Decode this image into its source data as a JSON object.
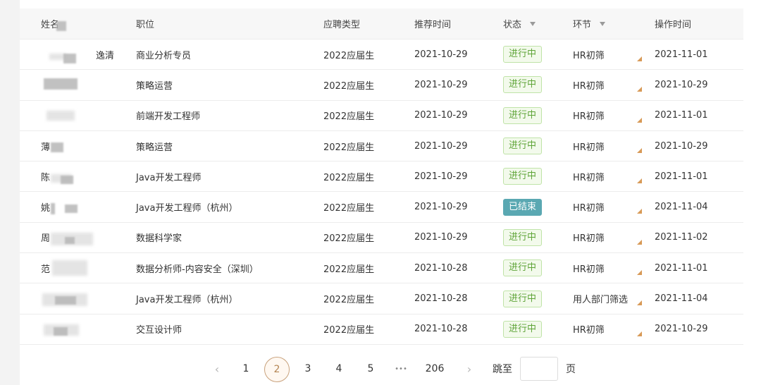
{
  "table": {
    "headers": {
      "name": "姓名",
      "position": "职位",
      "type": "应聘类型",
      "rec_time": "推荐时间",
      "status": "状态",
      "stage": "环节",
      "op_time": "操作时间"
    },
    "rows": [
      {
        "name": "逸清",
        "position": "商业分析专员",
        "type": "2022应届生",
        "rec_time": "2021-10-29",
        "status": "进行中",
        "status_kind": "ongoing",
        "stage": "HR初筛",
        "op_time": "2021-11-01"
      },
      {
        "name": "",
        "position": "策略运营",
        "type": "2022应届生",
        "rec_time": "2021-10-29",
        "status": "进行中",
        "status_kind": "ongoing",
        "stage": "HR初筛",
        "op_time": "2021-10-29"
      },
      {
        "name": "",
        "position": "前端开发工程师",
        "type": "2022应届生",
        "rec_time": "2021-10-29",
        "status": "进行中",
        "status_kind": "ongoing",
        "stage": "HR初筛",
        "op_time": "2021-11-01"
      },
      {
        "name": "薄",
        "position": "策略运营",
        "type": "2022应届生",
        "rec_time": "2021-10-29",
        "status": "进行中",
        "status_kind": "ongoing",
        "stage": "HR初筛",
        "op_time": "2021-10-29"
      },
      {
        "name": "陈",
        "position": "Java开发工程师",
        "type": "2022应届生",
        "rec_time": "2021-10-29",
        "status": "进行中",
        "status_kind": "ongoing",
        "stage": "HR初筛",
        "op_time": "2021-11-01"
      },
      {
        "name": "姚",
        "position": "Java开发工程师（杭州）",
        "type": "2022应届生",
        "rec_time": "2021-10-29",
        "status": "已结束",
        "status_kind": "ended",
        "stage": "HR初筛",
        "op_time": "2021-11-04"
      },
      {
        "name": "周",
        "position": "数据科学家",
        "type": "2022应届生",
        "rec_time": "2021-10-29",
        "status": "进行中",
        "status_kind": "ongoing",
        "stage": "HR初筛",
        "op_time": "2021-11-02"
      },
      {
        "name": "范",
        "position": "数据分析师-内容安全（深圳）",
        "type": "2022应届生",
        "rec_time": "2021-10-28",
        "status": "进行中",
        "status_kind": "ongoing",
        "stage": "HR初筛",
        "op_time": "2021-11-01"
      },
      {
        "name": "",
        "position": "Java开发工程师（杭州）",
        "type": "2022应届生",
        "rec_time": "2021-10-28",
        "status": "进行中",
        "status_kind": "ongoing",
        "stage": "用人部门筛选",
        "op_time": "2021-11-04"
      },
      {
        "name": "",
        "position": "交互设计师",
        "type": "2022应届生",
        "rec_time": "2021-10-28",
        "status": "进行中",
        "status_kind": "ongoing",
        "stage": "HR初筛",
        "op_time": "2021-10-29"
      }
    ]
  },
  "pagination": {
    "prev": "‹",
    "pages": [
      "1",
      "2",
      "3",
      "4",
      "5"
    ],
    "current": "2",
    "ellipsis": "•••",
    "last": "206",
    "next": "›",
    "jump_label": "跳至",
    "page_suffix": "页",
    "jump_value": ""
  },
  "colors": {
    "ongoing": "#5ea437",
    "ended": "#5aa8b2",
    "accent": "#b48452"
  }
}
